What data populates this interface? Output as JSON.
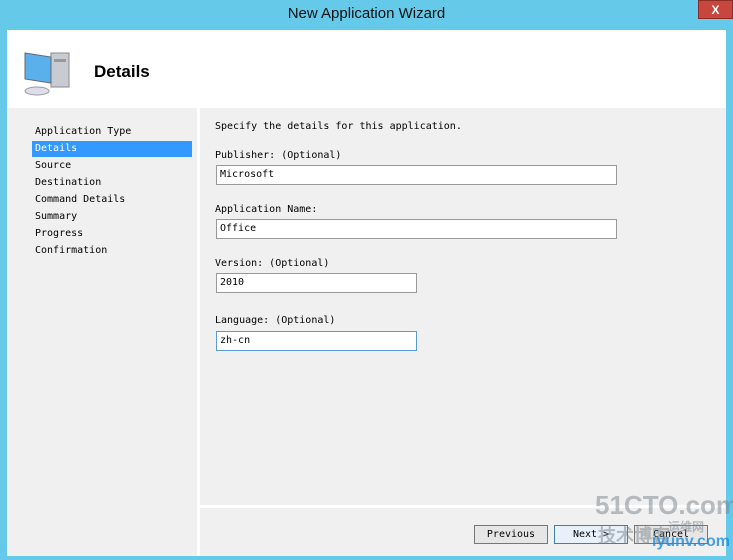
{
  "window": {
    "title": "New Application Wizard",
    "close_label": "X"
  },
  "header": {
    "title": "Details",
    "icon": "computer-icon"
  },
  "nav": [
    {
      "label": "Application Type"
    },
    {
      "label": "Details",
      "selected": true
    },
    {
      "label": "Source"
    },
    {
      "label": "Destination"
    },
    {
      "label": "Command Details"
    },
    {
      "label": "Summary"
    },
    {
      "label": "Progress"
    },
    {
      "label": "Confirmation"
    }
  ],
  "form": {
    "instruction": "Specify the details for this application.",
    "publisher": {
      "label": "Publisher: (Optional)",
      "value": "Microsoft"
    },
    "app_name": {
      "label": "Application Name:",
      "value": "Office"
    },
    "version": {
      "label": "Version: (Optional)",
      "value": "2010"
    },
    "language": {
      "label": "Language: (Optional)",
      "value": "zh-cn"
    }
  },
  "buttons": {
    "previous": "Previous",
    "next": "Next >",
    "cancel": "Cancel"
  },
  "watermark": {
    "line1": "51CTO.com",
    "line2": "技术博客",
    "line3": "运维网",
    "line4": "iyunv.com"
  }
}
